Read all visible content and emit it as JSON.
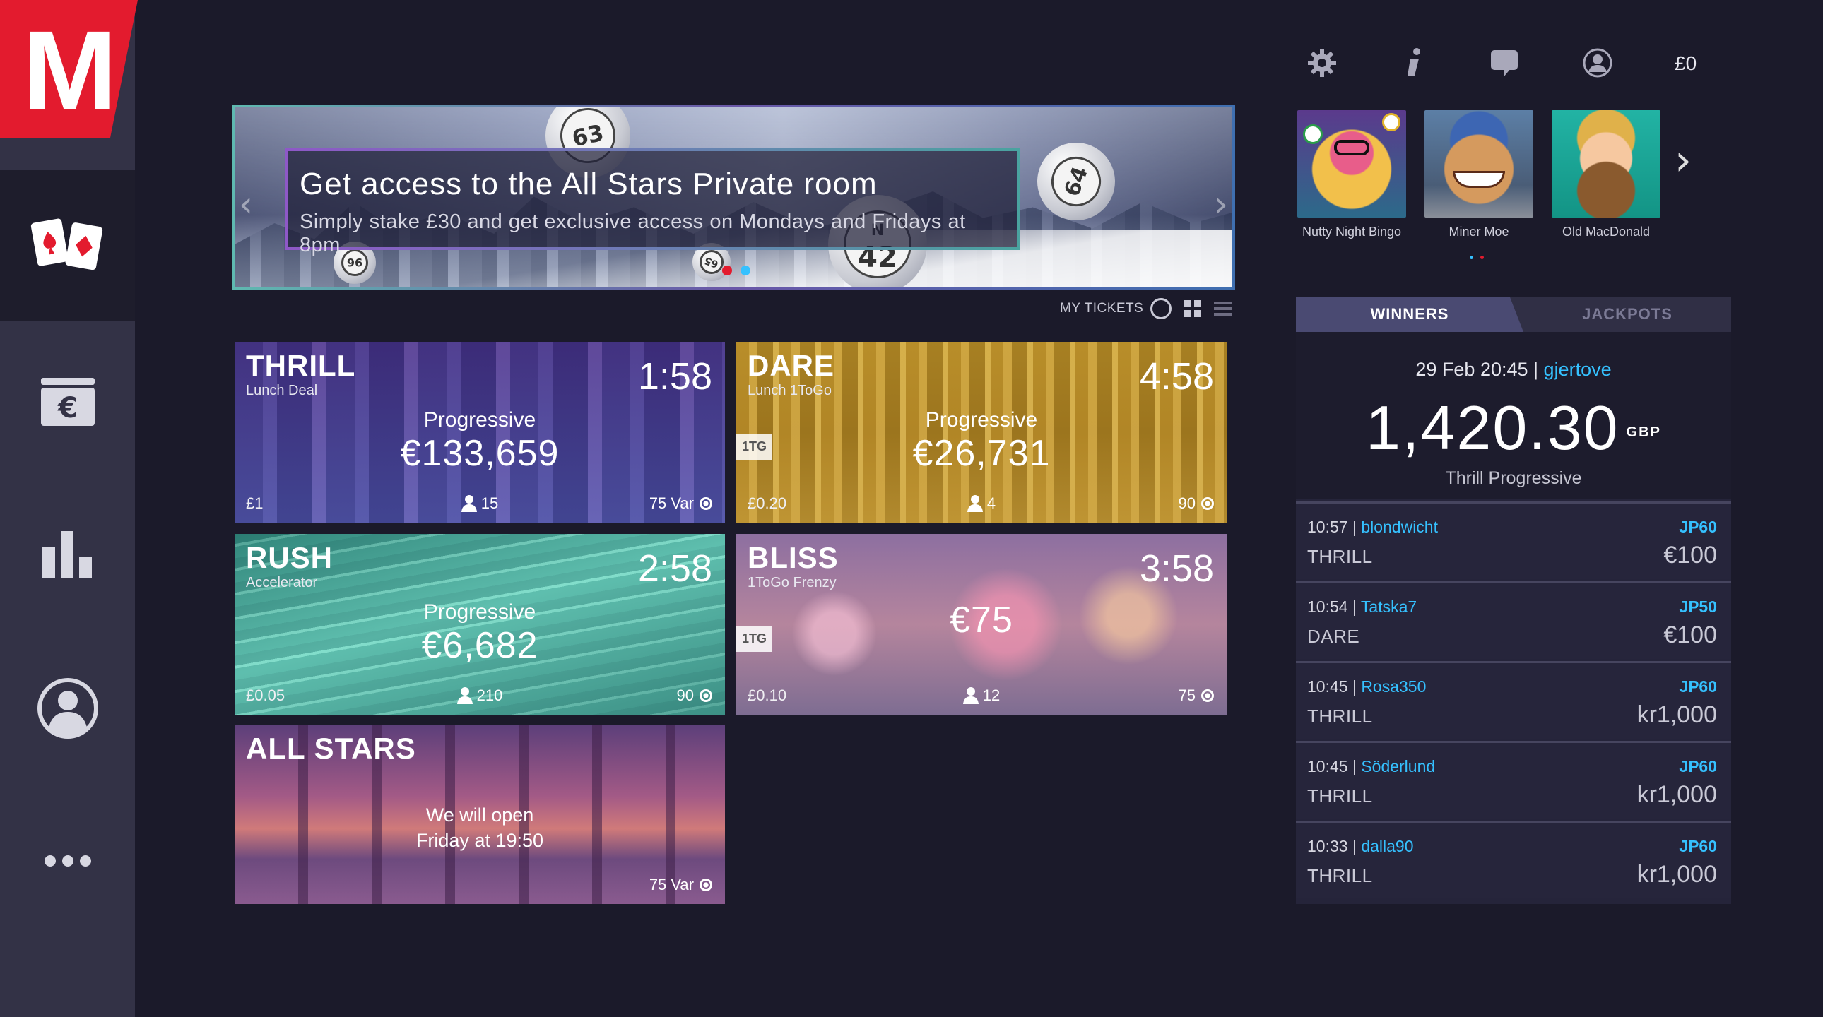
{
  "app": {
    "logo_letter": "M"
  },
  "nav": [
    "cards-icon",
    "wallet-icon",
    "stats-icon",
    "profile-icon",
    "more-icon"
  ],
  "banner": {
    "title": "Get access to the All Stars Private room",
    "subtitle": "Simply stake £30 and get exclusive access on Mondays and Fridays at 8pm",
    "ball_numbers": [
      "63",
      "64",
      "42",
      "N",
      "96",
      "65"
    ],
    "dot_colors": [
      "#e31b2e",
      "#35c1ff"
    ]
  },
  "my_tickets": {
    "label": "MY TICKETS"
  },
  "rooms": [
    {
      "name": "THRILL",
      "sub": "Lunch Deal",
      "timer": "1:58",
      "prog_label": "Progressive",
      "amount": "€133,659",
      "price": "£1",
      "players": "15",
      "variant": "75 Var"
    },
    {
      "name": "DARE",
      "sub": "Lunch 1ToGo",
      "timer": "4:58",
      "prog_label": "Progressive",
      "amount": "€26,731",
      "price": "£0.20",
      "players": "4",
      "variant": "90",
      "tag": "1TG"
    },
    {
      "name": "RUSH",
      "sub": "Accelerator",
      "timer": "2:58",
      "prog_label": "Progressive",
      "amount": "€6,682",
      "price": "£0.05",
      "players": "210",
      "variant": "90"
    },
    {
      "name": "BLISS",
      "sub": "1ToGo Frenzy",
      "timer": "3:58",
      "amount": "€75",
      "price": "£0.10",
      "players": "12",
      "variant": "75",
      "tag": "1TG"
    },
    {
      "name": "ALL STARS",
      "closed_line1": "We will open",
      "closed_line2": "Friday at 19:50",
      "variant": "75 Var"
    }
  ],
  "topbar": {
    "balance": "£0",
    "icons": [
      "settings-icon",
      "info-icon",
      "chat-icon",
      "account-icon"
    ]
  },
  "games": [
    {
      "label": "Nutty Night Bingo"
    },
    {
      "label": "Miner Moe"
    },
    {
      "label": "Old MacDonald"
    }
  ],
  "winners": {
    "tab_winners": "WINNERS",
    "tab_jackpots": "JACKPOTS",
    "featured": {
      "when": "29 Feb 20:45 | ",
      "user": "gjertove",
      "amount": "1,420.30",
      "currency": "GBP",
      "game": "Thrill Progressive"
    },
    "rows": [
      {
        "time": "10:57 | ",
        "user": "blondwicht",
        "jp": "JP60",
        "room": "THRILL",
        "win": "€100"
      },
      {
        "time": "10:54 | ",
        "user": "Tatska7",
        "jp": "JP50",
        "room": "DARE",
        "win": "€100"
      },
      {
        "time": "10:45 | ",
        "user": "Rosa350",
        "jp": "JP60",
        "room": "THRILL",
        "win": "kr1,000"
      },
      {
        "time": "10:45 | ",
        "user": "Söderlund",
        "jp": "JP60",
        "room": "THRILL",
        "win": "kr1,000"
      },
      {
        "time": "10:33 | ",
        "user": "dalla90",
        "jp": "JP60",
        "room": "THRILL",
        "win": "kr1,000"
      }
    ]
  },
  "colors": {
    "accent": "#35c1ff",
    "brand": "#e31b2e",
    "rail": "#333246",
    "background": "#1b1a2a"
  }
}
